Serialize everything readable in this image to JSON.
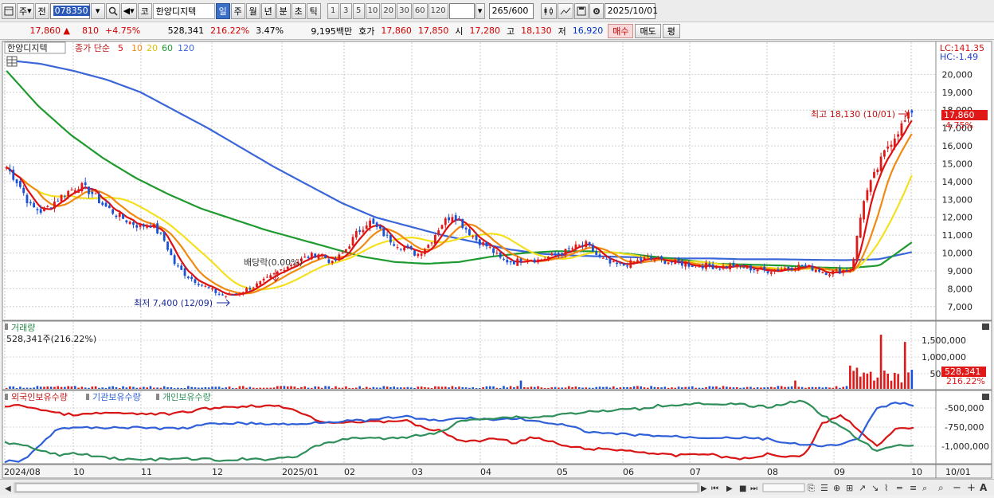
{
  "toolbar": {
    "market_btn": "주",
    "prev_btn": "전",
    "code": "078350",
    "kr_btn": "코",
    "name": "한양디지텍",
    "periods": [
      "일",
      "주",
      "월",
      "년",
      "분",
      "초",
      "틱"
    ],
    "active_period": "일",
    "intervals": [
      "1",
      "3",
      "5",
      "10",
      "20",
      "30",
      "60",
      "120"
    ],
    "count": "265",
    "count_total": "/600",
    "date": "2025/10/01"
  },
  "quote": {
    "price": "17,860",
    "change": "810",
    "change_pct": "+4.75%",
    "volume": "528,341",
    "volume_pct": "216.22%",
    "turnover_pct": "3.47%",
    "amount": "9,195백만",
    "hoga_label": "호가",
    "ask": "17,860",
    "bid": "17,850",
    "open_label": "시",
    "open": "17,280",
    "high_label": "고",
    "high": "18,130",
    "low_label": "저",
    "low": "16,920",
    "buy_btn": "매수",
    "sell_btn": "매도",
    "eval_btn": "평"
  },
  "legend": {
    "name": "한양디지텍",
    "ma_title": "종가 단순",
    "ma_periods": [
      "5",
      "10",
      "20",
      "60",
      "120"
    ],
    "lc": "LC:141.35",
    "hc": "HC:-1.49",
    "last_price": "17,860",
    "last_pct": "4.75%",
    "high_note": "최고 18,130 (10/01)",
    "low_note": "최저 7,400 (12/09)",
    "dividend_note": "배당락(0.00%)"
  },
  "volume_panel": {
    "title": "거래량",
    "value": "528,341주(216.22%)",
    "last": "528,341",
    "last_pct": "216.22%",
    "ticks": [
      "1,500,000",
      "1,000,000",
      "500,000"
    ]
  },
  "holder_panel": {
    "series": [
      "외국인보유수량",
      "기관보유수량",
      "개인보유수량"
    ],
    "ticks": [
      "-500,000",
      "-750,000",
      "-1,000,000"
    ]
  },
  "x_axis": [
    "2024/08",
    "10",
    "11",
    "12",
    "2025/01",
    "02",
    "03",
    "04",
    "05",
    "06",
    "07",
    "08",
    "09",
    "10",
    "10/01"
  ],
  "price_ticks": [
    "20,000",
    "19,000",
    "18,000",
    "17,000",
    "16,000",
    "15,000",
    "14,000",
    "13,000",
    "12,000",
    "11,000",
    "10,000",
    "9,000",
    "8,000",
    "7,000"
  ],
  "colors": {
    "up": "#e01818",
    "down": "#1a52d6",
    "ma5": "#e01010",
    "ma10": "#f08a10",
    "ma20": "#f5e020",
    "ma60": "#1f9a2f",
    "ma120": "#3a66d8",
    "foreign": "#d81414",
    "inst": "#2e5ed8",
    "indiv": "#2f8f5a"
  },
  "chart_data": {
    "type": "candlestick",
    "title": "한양디지텍",
    "ylim": [
      6500,
      21000
    ],
    "x_labels": [
      "2024/08",
      "10",
      "11",
      "12",
      "2025/01",
      "02",
      "03",
      "04",
      "05",
      "06",
      "07",
      "08",
      "09",
      "10"
    ],
    "close_path": [
      14800,
      13900,
      12600,
      12300,
      12900,
      13400,
      13800,
      13400,
      12700,
      12200,
      11800,
      11500,
      11600,
      10800,
      9300,
      8700,
      8300,
      7900,
      7600,
      7700,
      8000,
      8300,
      8700,
      9200,
      9500,
      9800,
      10000,
      9400,
      10100,
      11100,
      11800,
      11200,
      10600,
      10300,
      9900,
      10500,
      11600,
      12200,
      11400,
      10700,
      10300,
      9600,
      9500,
      9700,
      9600,
      9800,
      10000,
      10300,
      10500,
      9800,
      9400,
      9300,
      9500,
      9700,
      9600,
      9500,
      9400,
      9300,
      9300,
      9200,
      9300,
      9200,
      9100,
      9000,
      9100,
      9200,
      9300,
      9100,
      8900,
      9000,
      9100,
      13000,
      14500,
      16000,
      17000,
      17860
    ],
    "high": 18130,
    "low": 7400,
    "last_close": 17860,
    "ma120_path": [
      20800,
      20600,
      20200,
      19700,
      19000,
      18000,
      17000,
      15900,
      14800,
      13800,
      12800,
      12000,
      11500,
      11000,
      10600,
      10200,
      9950,
      9850,
      9800,
      9750,
      9700,
      9700,
      9650,
      9650,
      9620,
      9600,
      9650,
      10050
    ],
    "ma60_path": [
      20200,
      18200,
      16600,
      15300,
      14200,
      13300,
      12500,
      11900,
      11300,
      10800,
      10300,
      9800,
      9500,
      9400,
      9500,
      9800,
      10000,
      10100,
      10100,
      10000,
      9800,
      9600,
      9400,
      9350,
      9300,
      9200,
      9150,
      9300,
      10600
    ],
    "volume_max": 1700000,
    "volume_last": 528341,
    "holder_ylim": [
      -1150000,
      -400000
    ]
  }
}
